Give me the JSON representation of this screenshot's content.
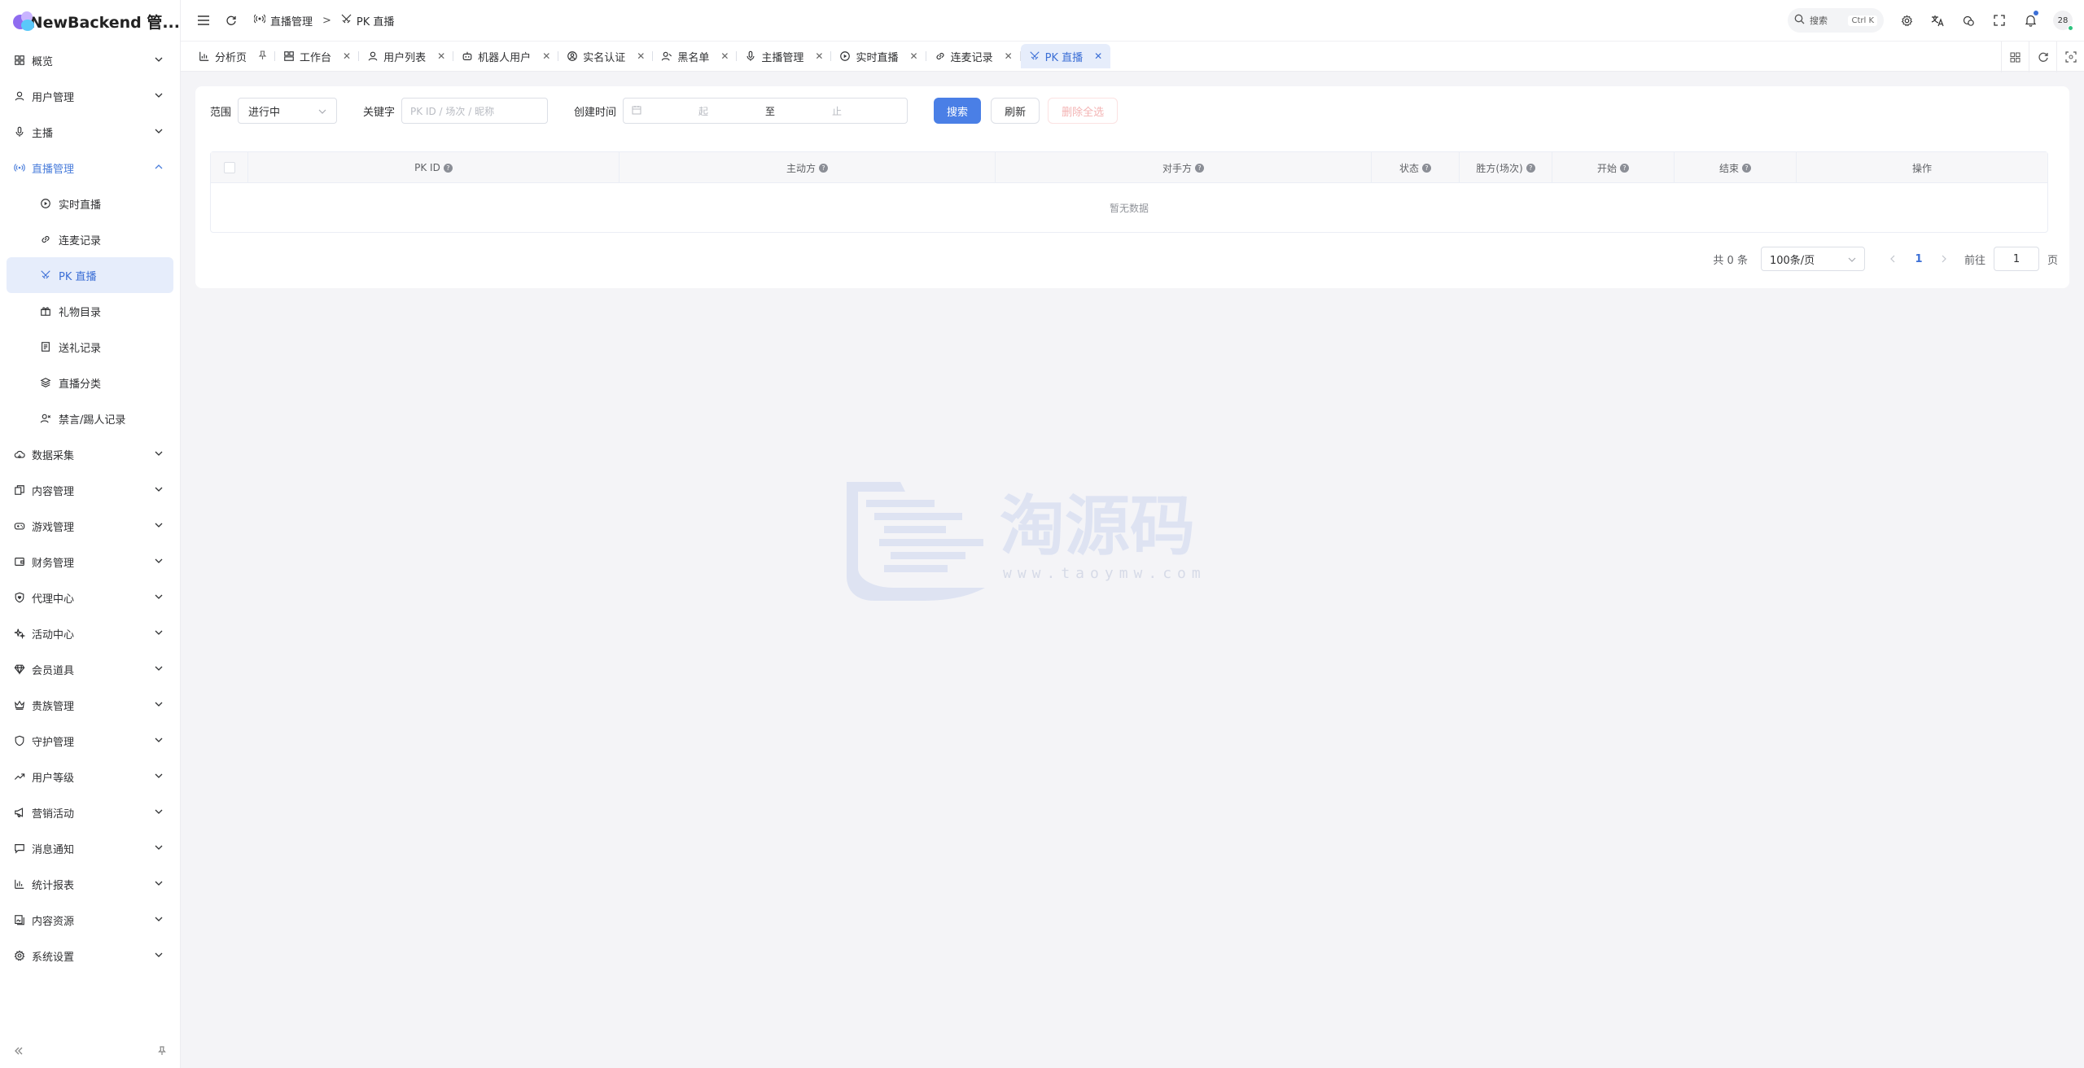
{
  "brand": {
    "title": "NewBackend 管..."
  },
  "sidebar": {
    "items": [
      {
        "label": "概览",
        "icon": "grid-icon",
        "expanded": false
      },
      {
        "label": "用户管理",
        "icon": "user-icon",
        "expanded": false
      },
      {
        "label": "主播",
        "icon": "mic-icon",
        "expanded": false
      },
      {
        "label": "直播管理",
        "icon": "broadcast-icon",
        "expanded": true,
        "children": [
          {
            "label": "实时直播",
            "icon": "play-circle-icon"
          },
          {
            "label": "连麦记录",
            "icon": "link-icon"
          },
          {
            "label": "PK 直播",
            "icon": "swords-icon",
            "selected": true
          },
          {
            "label": "礼物目录",
            "icon": "gift-icon"
          },
          {
            "label": "送礼记录",
            "icon": "receipt-icon"
          },
          {
            "label": "直播分类",
            "icon": "layers-icon"
          },
          {
            "label": "禁言/踢人记录",
            "icon": "user-x-icon"
          }
        ]
      },
      {
        "label": "数据采集",
        "icon": "cloud-icon",
        "expanded": false
      },
      {
        "label": "内容管理",
        "icon": "copy-icon",
        "expanded": false
      },
      {
        "label": "游戏管理",
        "icon": "gamepad-icon",
        "expanded": false
      },
      {
        "label": "财务管理",
        "icon": "wallet-icon",
        "expanded": false
      },
      {
        "label": "代理中心",
        "icon": "shield-heart-icon",
        "expanded": false
      },
      {
        "label": "活动中心",
        "icon": "sparkles-icon",
        "expanded": false
      },
      {
        "label": "会员道具",
        "icon": "gem-icon",
        "expanded": false
      },
      {
        "label": "贵族管理",
        "icon": "crown-icon",
        "expanded": false
      },
      {
        "label": "守护管理",
        "icon": "shield-icon",
        "expanded": false
      },
      {
        "label": "用户等级",
        "icon": "trending-up-icon",
        "expanded": false
      },
      {
        "label": "营销活动",
        "icon": "megaphone-icon",
        "expanded": false
      },
      {
        "label": "消息通知",
        "icon": "message-icon",
        "expanded": false
      },
      {
        "label": "统计报表",
        "icon": "bar-chart-icon",
        "expanded": false
      },
      {
        "label": "内容资源",
        "icon": "image-library-icon",
        "expanded": false
      },
      {
        "label": "系统设置",
        "icon": "gear-icon",
        "expanded": false
      }
    ]
  },
  "header": {
    "breadcrumb": [
      "直播管理",
      "PK 直播"
    ],
    "search_label": "搜索",
    "search_shortcut": "Ctrl K",
    "avatar_text": "28"
  },
  "tabs": [
    {
      "label": "分析页",
      "icon": "chart-icon",
      "closable": false,
      "pinned": true
    },
    {
      "label": "工作台",
      "icon": "workbench-icon",
      "closable": true
    },
    {
      "label": "用户列表",
      "icon": "user-icon",
      "closable": true
    },
    {
      "label": "机器人用户",
      "icon": "robot-icon",
      "closable": true
    },
    {
      "label": "实名认证",
      "icon": "idcard-icon",
      "closable": true
    },
    {
      "label": "黑名单",
      "icon": "user-block-icon",
      "closable": true
    },
    {
      "label": "主播管理",
      "icon": "mic-icon",
      "closable": true
    },
    {
      "label": "实时直播",
      "icon": "play-circle-icon",
      "closable": true
    },
    {
      "label": "连麦记录",
      "icon": "link-icon",
      "closable": true
    },
    {
      "label": "PK 直播",
      "icon": "swords-icon",
      "closable": true,
      "active": true
    }
  ],
  "filters": {
    "scope_label": "范围",
    "scope_value": "进行中",
    "keyword_label": "关键字",
    "keyword_placeholder": "PK ID / 场次 / 昵称",
    "created_label": "创建时间",
    "date_start_placeholder": "起",
    "date_sep": "至",
    "date_end_placeholder": "止",
    "search_btn": "搜索",
    "refresh_btn": "刷新",
    "delete_btn": "删除全选"
  },
  "table": {
    "columns": [
      {
        "label": "PK ID",
        "help": true
      },
      {
        "label": "主动方",
        "help": true
      },
      {
        "label": "对手方",
        "help": true
      },
      {
        "label": "状态",
        "help": true
      },
      {
        "label": "胜方(场次)",
        "help": true
      },
      {
        "label": "开始",
        "help": true
      },
      {
        "label": "结束",
        "help": true
      },
      {
        "label": "操作",
        "help": false
      }
    ],
    "empty_text": "暂无数据"
  },
  "pagination": {
    "total_text": "共 0 条",
    "page_size": "100条/页",
    "current_page": "1",
    "goto_label": "前往",
    "goto_value": "1",
    "page_suffix": "页"
  },
  "watermark": {
    "text": "淘源码",
    "url": "www.taoymw.com"
  },
  "colors": {
    "accent": "#4a7fe6",
    "selected_bg": "#e6edfb",
    "page_bg": "#f4f4f7"
  }
}
